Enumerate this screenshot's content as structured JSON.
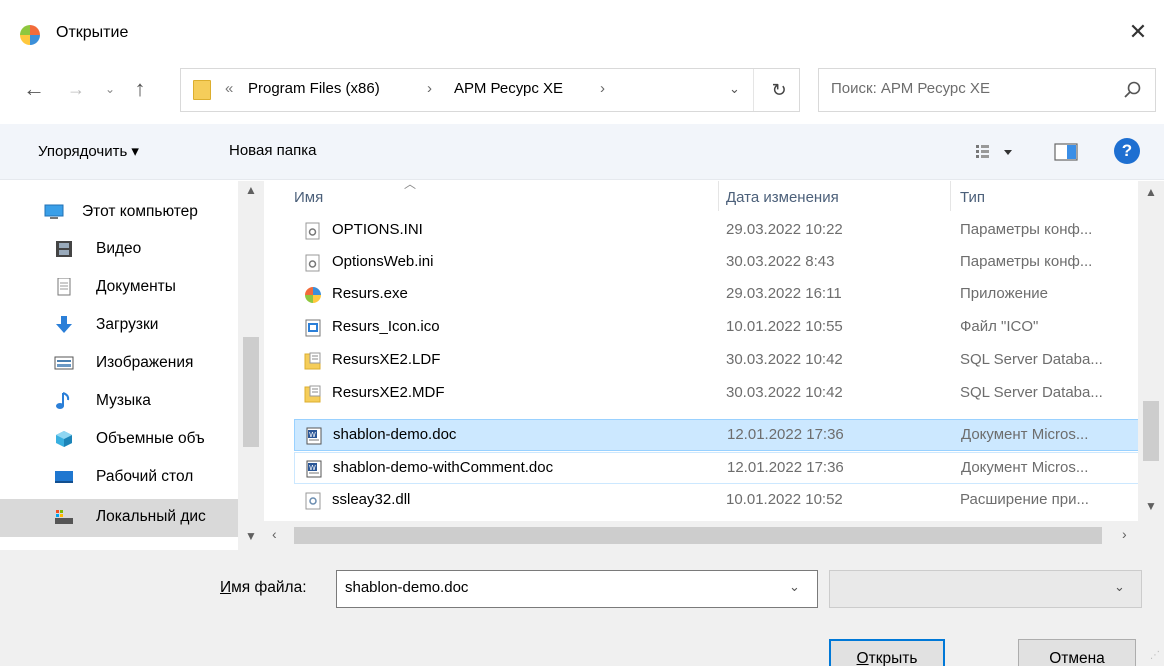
{
  "window": {
    "title": "Открытие",
    "close_glyph": "✕"
  },
  "nav": {
    "back_glyph": "←",
    "forward_glyph": "→",
    "recent_glyph": "⌄",
    "up_glyph": "↑"
  },
  "address": {
    "overflow": "«",
    "crumbs": [
      "Program Files (x86)",
      "АРМ Ресурс XE"
    ],
    "separator": "›",
    "dropdown_glyph": "⌄",
    "refresh_glyph": "↻"
  },
  "search": {
    "placeholder": "Поиск: АРМ Ресурс XE"
  },
  "toolbar": {
    "organize_label": "Упорядочить ▾",
    "new_folder_label": "Новая папка",
    "help_label": "?"
  },
  "navigation_pane": {
    "items": [
      {
        "label": "Этот компьютер",
        "icon": "computer-icon"
      },
      {
        "label": "Видео",
        "icon": "video-icon"
      },
      {
        "label": "Документы",
        "icon": "documents-icon"
      },
      {
        "label": "Загрузки",
        "icon": "downloads-icon"
      },
      {
        "label": "Изображения",
        "icon": "pictures-icon"
      },
      {
        "label": "Музыка",
        "icon": "music-icon"
      },
      {
        "label": "Объемные объ",
        "icon": "3d-objects-icon"
      },
      {
        "label": "Рабочий стол",
        "icon": "desktop-icon"
      },
      {
        "label": "Локальный дис",
        "icon": "local-disk-icon"
      }
    ],
    "selected_index": 8
  },
  "file_list": {
    "columns": [
      "Имя",
      "Дата изменения",
      "Тип"
    ],
    "rows": [
      {
        "name": "OPTIONS.INI",
        "date": "29.03.2022 10:22",
        "type": "Параметры конф...",
        "icon": "settings-file-icon"
      },
      {
        "name": "OptionsWeb.ini",
        "date": "30.03.2022 8:43",
        "type": "Параметры конф...",
        "icon": "settings-file-icon"
      },
      {
        "name": "Resurs.exe",
        "date": "29.03.2022 16:11",
        "type": "Приложение",
        "icon": "app-icon"
      },
      {
        "name": "Resurs_Icon.ico",
        "date": "10.01.2022 10:55",
        "type": "Файл \"ICO\"",
        "icon": "image-file-icon"
      },
      {
        "name": "ResursXE2.LDF",
        "date": "30.03.2022 10:42",
        "type": "SQL Server Databa...",
        "icon": "database-file-icon"
      },
      {
        "name": "ResursXE2.MDF",
        "date": "30.03.2022 10:42",
        "type": "SQL Server Databa...",
        "icon": "database-file-icon"
      },
      {
        "name": "shablon-demo.doc",
        "date": "12.01.2022 17:36",
        "type": "Документ Micros...",
        "icon": "word-doc-icon"
      },
      {
        "name": "shablon-demo-withComment.doc",
        "date": "12.01.2022 17:36",
        "type": "Документ Micros...",
        "icon": "word-doc-icon"
      },
      {
        "name": "ssleay32.dll",
        "date": "10.01.2022 10:52",
        "type": "Расширение при...",
        "icon": "dll-file-icon"
      }
    ],
    "selected_index": 6
  },
  "bottom": {
    "filename_label_underlined": "И",
    "filename_label_rest": "мя файла:",
    "filename_value": "shablon-demo.doc",
    "filter_value": "",
    "open_label_underlined": "О",
    "open_label_rest": "ткрыть",
    "cancel_label": "Отмена"
  },
  "colors": {
    "selection": "#cce8ff",
    "selection_border": "#99d1ff",
    "accent": "#0078d7",
    "help": "#1e6fd1"
  }
}
